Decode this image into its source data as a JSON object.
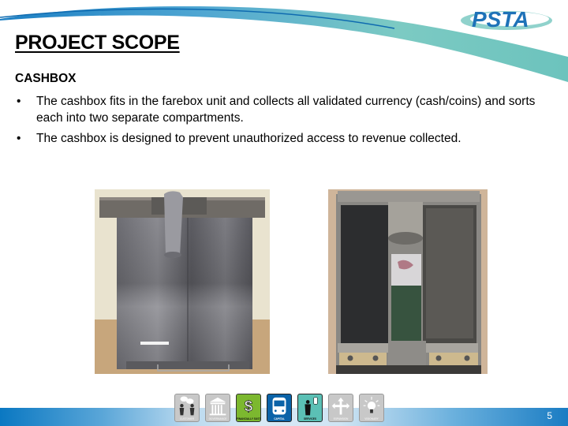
{
  "header": {
    "title": "PROJECT SCOPE",
    "logo_text": "PSTA"
  },
  "content": {
    "subtitle": "CASHBOX",
    "bullets": [
      "The cashbox fits in the farebox unit and collects all validated currency (cash/coins) and sorts each into two separate compartments.",
      "The cashbox is designed to prevent unauthorized access to revenue collected."
    ],
    "bullet_glyph": "•"
  },
  "images": [
    {
      "description": "Closed metal cashbox, front view with handle"
    },
    {
      "description": "Open cashbox, top view showing two compartments"
    }
  ],
  "footer": {
    "page_number": "5",
    "icons": [
      {
        "label": "CUSTOMER",
        "icon": "people-speech-icon",
        "active": false
      },
      {
        "label": "GOVERNANCE",
        "icon": "building-columns-icon",
        "active": false
      },
      {
        "label": "FINANCIALLY SUSTAINABLE",
        "icon": "dollar-icon",
        "active": true,
        "color": "#7cb82f"
      },
      {
        "label": "CAPITAL",
        "icon": "bus-icon",
        "active": true,
        "color": "#0b63a8"
      },
      {
        "label": "SERVICES",
        "icon": "person-pole-icon",
        "active": true,
        "color": "#5bc0b5"
      },
      {
        "label": "EXPANSION",
        "icon": "arrows-branch-icon",
        "active": false
      },
      {
        "label": "VISIONARY",
        "icon": "lightbulb-icon",
        "active": false
      }
    ]
  },
  "colors": {
    "swoosh_teal": "#6cc3bd",
    "swoosh_blue": "#1c7fc4",
    "logo_blue": "#1e72b8",
    "inactive_tile": "#c8c8c8"
  }
}
